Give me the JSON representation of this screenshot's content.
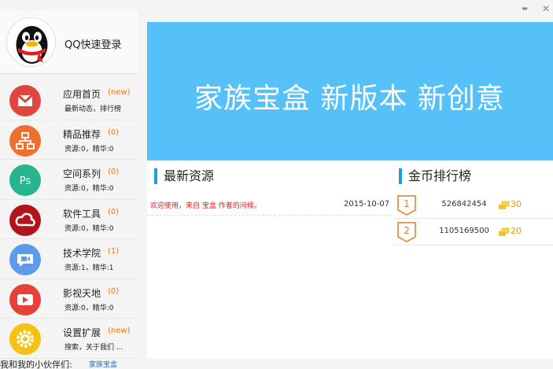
{
  "login": {
    "label": "QQ快速登录"
  },
  "menu": [
    {
      "key": "home",
      "icon": "mail-icon",
      "color": "#e0463d",
      "title": "应用首页",
      "badge": "(new)",
      "sub": "最新动态，排行榜"
    },
    {
      "key": "featured",
      "icon": "sitemap-icon",
      "color": "#ee7030",
      "title": "精品推荐",
      "badge": "(0)",
      "sub": "资源:0，精华:0"
    },
    {
      "key": "space",
      "icon": "ps-icon",
      "color": "#26b58f",
      "title": "空间系列",
      "badge": "(0)",
      "sub": "资源:0，精华:0"
    },
    {
      "key": "software",
      "icon": "creative-cloud-icon",
      "color": "#b2141b",
      "title": "软件工具",
      "badge": "(0)",
      "sub": "资源:0，精华:0"
    },
    {
      "key": "tech",
      "icon": "video-chat-icon",
      "color": "#5b9bea",
      "title": "技术学院",
      "badge": "(1)",
      "sub": "资源:1，精华:1"
    },
    {
      "key": "video",
      "icon": "play-icon",
      "color": "#e64137",
      "title": "影视天地",
      "badge": "(0)",
      "sub": "资源:0，精华:0"
    },
    {
      "key": "settings",
      "icon": "gear-icon",
      "color": "#f5c211",
      "title": "设置扩展",
      "badge": "(new)",
      "sub": "搜索，关于我们 ..."
    }
  ],
  "banner": {
    "text": "家族宝盒 新版本 新创意",
    "color": "#56c1f9"
  },
  "resources": {
    "heading": "最新资源",
    "items": [
      {
        "text": "欢迎使用，来自 宝盒 作者的问候。",
        "date": "2015-10-07"
      }
    ]
  },
  "ranking": {
    "heading": "金币排行榜",
    "items": [
      {
        "rank": "1",
        "id": "526842454",
        "coins": "30"
      },
      {
        "rank": "2",
        "id": "1105169500",
        "coins": "20"
      }
    ]
  },
  "footer": {
    "label": "我和我的小伙伴们:",
    "link": "家族宝盒"
  },
  "window": {
    "minimize": "▬",
    "close": "✕"
  }
}
